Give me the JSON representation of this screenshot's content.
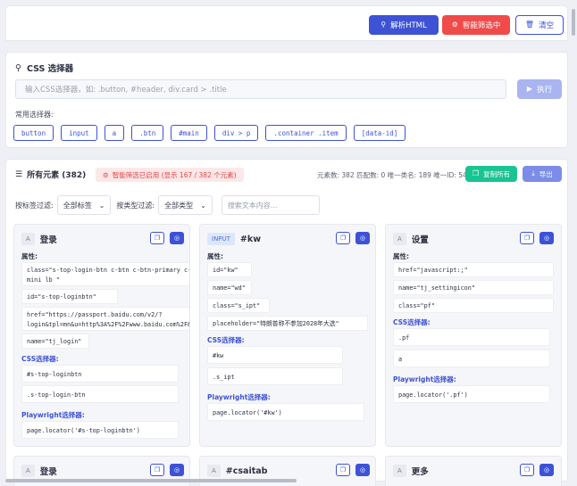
{
  "toolbar": {
    "parse_label": "解析HTML",
    "smart_label": "智能筛选中",
    "clear_label": "清空"
  },
  "css_selector": {
    "title": "CSS 选择器",
    "placeholder": "输入CSS选择器，如: .button, #header, div.card > .title",
    "exec_label": "执行",
    "common_label": "常用选择器:",
    "chips": [
      "button",
      "input",
      "a",
      ".btn",
      "#main",
      "div > p",
      ".container .item",
      "[data-id]"
    ]
  },
  "elements": {
    "title": "所有元素 (382)",
    "smart_badge": "智能筛选已启用 (显示 167 / 382 个元素)",
    "stats": "元素数: 382 匹配数: 0 唯一类名: 189 唯一ID: 54",
    "copy_all_label": "复制所有",
    "export_label": "导出",
    "tag_filter_label": "按标签过滤:",
    "tag_filter_value": "全部标签",
    "type_filter_label": "按类型过滤:",
    "type_filter_value": "全部类型",
    "search_placeholder": "搜索文本内容..."
  },
  "cards": [
    {
      "tag": "A",
      "title": "登录",
      "attr_label": "属性:",
      "attrs": [
        "class=\"s-top-login-btn c-btn c-btn-primary c-bt\nmini lb \"",
        "id=\"s-top-loginbtn\"",
        "href=\"https://passport.baidu.com/v2/?\nlogin&tpl=mn&u=http%3A%2F%2Fwww.baidu.com%2F&sm",
        "name=\"tj_login\""
      ],
      "css_label": "CSS选择器:",
      "css": [
        "#s-top-loginbtn",
        ".s-top-login-btn"
      ],
      "pw_label": "Playwright选择器:",
      "pw": "page.locator('#s-top-loginbtn')"
    },
    {
      "tag": "INPUT",
      "title": "#kw",
      "attr_label": "属性:",
      "attrs": [
        "id=\"kw\"",
        "name=\"wd\"",
        "class=\"s_ipt\"",
        "placeholder=\"特朗普称不参加2028年大选\""
      ],
      "css_label": "CSS选择器:",
      "css": [
        "#kw",
        ".s_ipt"
      ],
      "pw_label": "Playwright选择器:",
      "pw": "page.locator('#kw')"
    },
    {
      "tag": "A",
      "title": "设置",
      "attr_label": "属性:",
      "attrs": [
        "href=\"javascript:;\"",
        "name=\"tj_settingicon\"",
        "class=\"pf\""
      ],
      "css_label": "CSS选择器:",
      "css": [
        ".pf",
        "a"
      ],
      "pw_label": "Playwright选择器:",
      "pw": "page.locator('.pf')"
    }
  ],
  "cards_row2": [
    {
      "tag": "A",
      "title": "登录"
    },
    {
      "tag": "A",
      "title": "#csaitab"
    },
    {
      "tag": "A",
      "title": "更多"
    }
  ],
  "colors": {
    "primary": "#3d52d5",
    "danger": "#f04a4a",
    "success": "#19c392",
    "export": "#7c8ce8"
  }
}
